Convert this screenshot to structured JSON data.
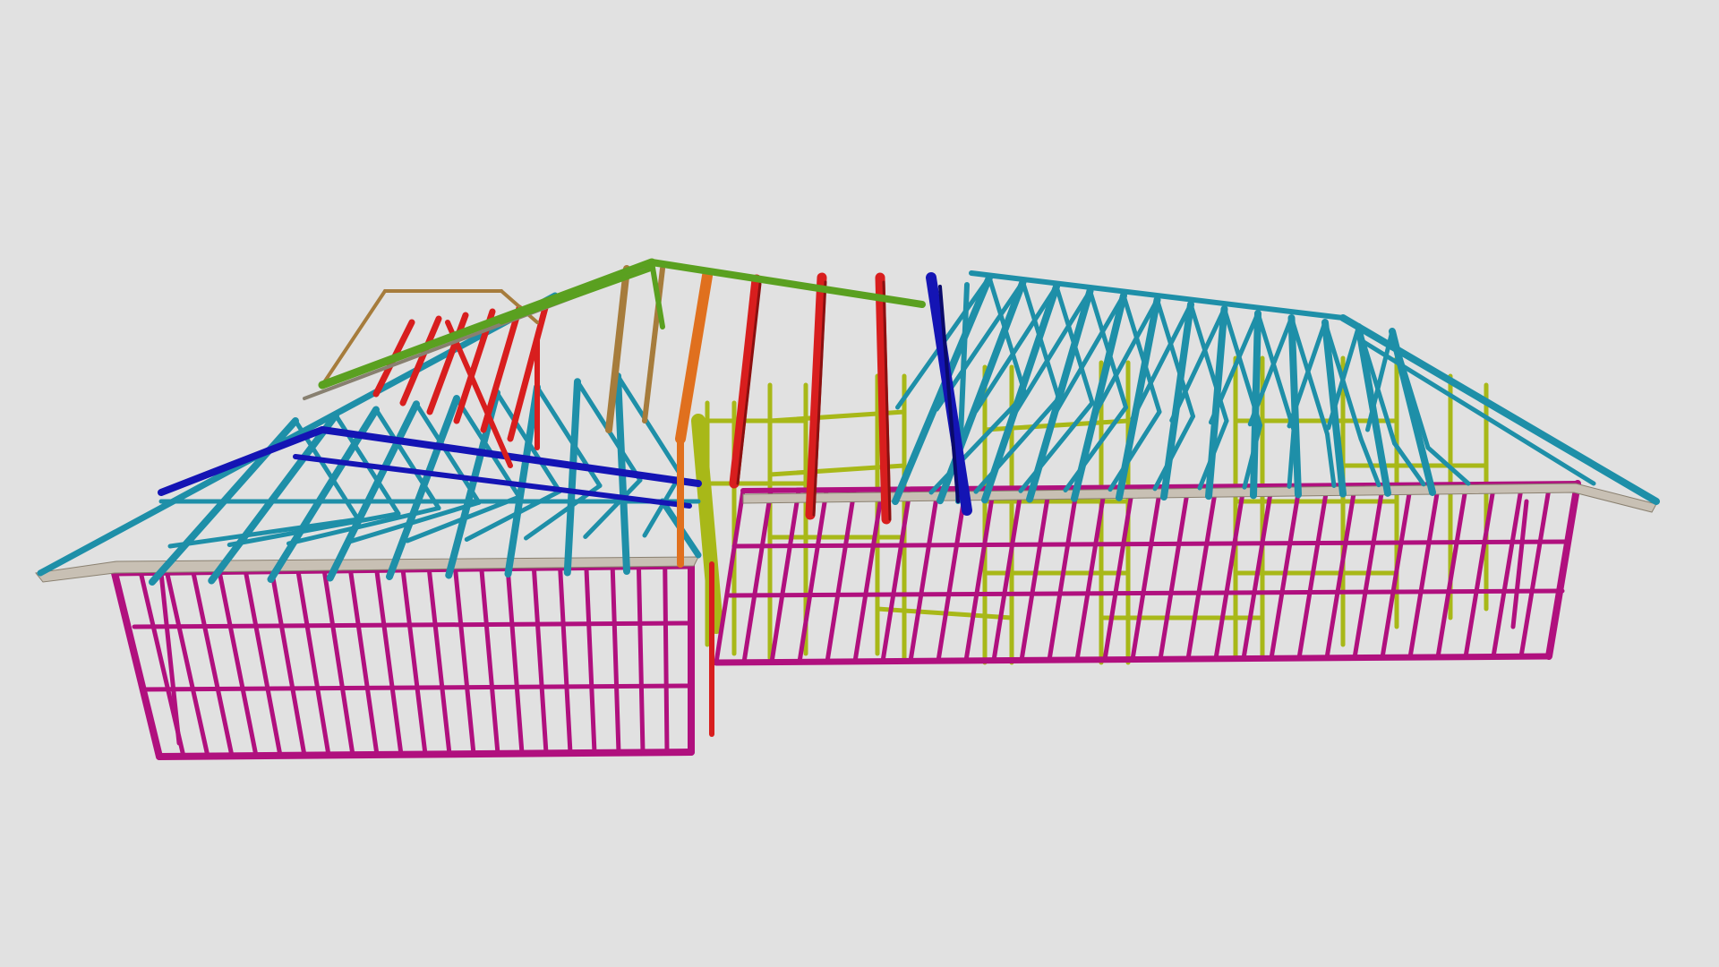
{
  "viewer": {
    "background_color": "#e1e1e1"
  },
  "model": {
    "subject": "steel-house-frame-with-roof-trusses",
    "member_colors": {
      "wall_frame": "#b0107e",
      "interior_wall_frame": "#a8b818",
      "common_truss": "#1e8fa8",
      "hip_truss_red": "#d81e1e",
      "hip_girder_blue": "#1414b4",
      "ridge_green": "#5aa020",
      "truss_brown": "#a67c3c",
      "truss_orange": "#e0701e",
      "fascia": "#c8c0b4"
    }
  }
}
